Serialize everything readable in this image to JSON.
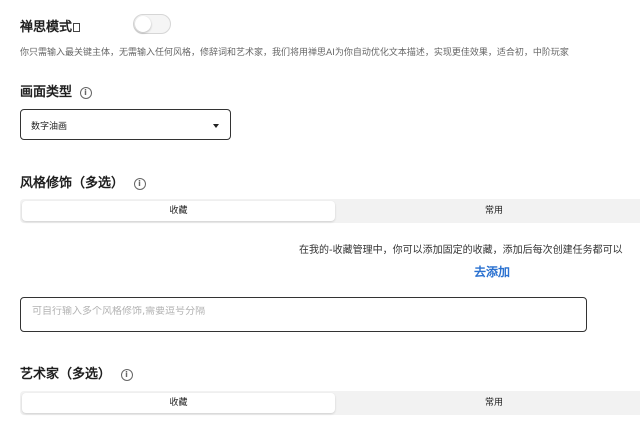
{
  "zen_mode": {
    "title": "禅思模式",
    "enabled": false,
    "description": "你只需输入最关键主体，无需输入任何风格，修辞词和艺术家，我们将用禅思AI为你自动优化文本描述，实现更佳效果，适合初，中阶玩家"
  },
  "image_type": {
    "title": "画面类型",
    "selected": "数字油画"
  },
  "style_modifiers": {
    "title": "风格修饰（多选）",
    "tabs": [
      "收藏",
      "常用"
    ],
    "active_tab": "收藏",
    "note": "在我的-收藏管理中，你可以添加固定的收藏，添加后每次创建任务都可以",
    "add_link": "去添加",
    "input_placeholder": "可自行输入多个风格修饰,需要逗号分隔"
  },
  "artists": {
    "title": "艺术家（多选）",
    "tabs": [
      "收藏",
      "常用"
    ],
    "active_tab": "收藏"
  },
  "icons": {
    "info": "info-circle-icon",
    "caret": "caret-down-icon"
  },
  "colors": {
    "link": "#2a71d0",
    "segment_bg": "#f2f2f2"
  }
}
